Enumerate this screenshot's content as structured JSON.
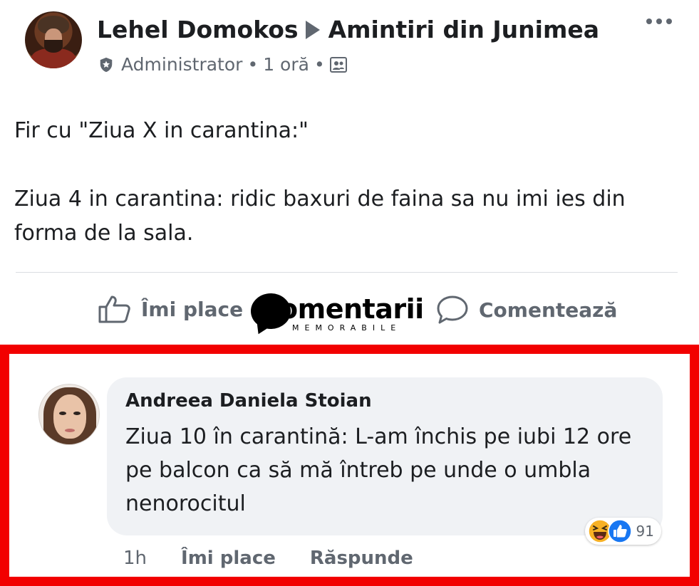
{
  "post": {
    "author": "Lehel Domokos",
    "group": "Amintiri din Junimea",
    "role": "Administrator",
    "time": "1 oră",
    "separator": "•",
    "body": [
      "Fir cu \"Ziua X in carantina:\"",
      "Ziua 4 in carantina: ridic baxuri de faina sa nu imi ies din forma de la sala."
    ],
    "actions": {
      "like": "Îmi place",
      "comment": "Comentează"
    }
  },
  "watermark": {
    "main": "omentarii",
    "sub": "MEMORABILE"
  },
  "comment": {
    "author": "Andreea Daniela Stoian",
    "text": "Ziua 10 în carantină: L-am închis pe iubi 12 ore pe balcon ca să mă întreb pe unde o umbla nenorocitul",
    "time": "1h",
    "like": "Îmi place",
    "reply": "Răspunde",
    "reaction_count": "91"
  },
  "colors": {
    "highlight_border": "#f20000",
    "bubble_bg": "#f0f2f5",
    "like_blue": "#1877f2",
    "meta_gray": "#606770"
  }
}
